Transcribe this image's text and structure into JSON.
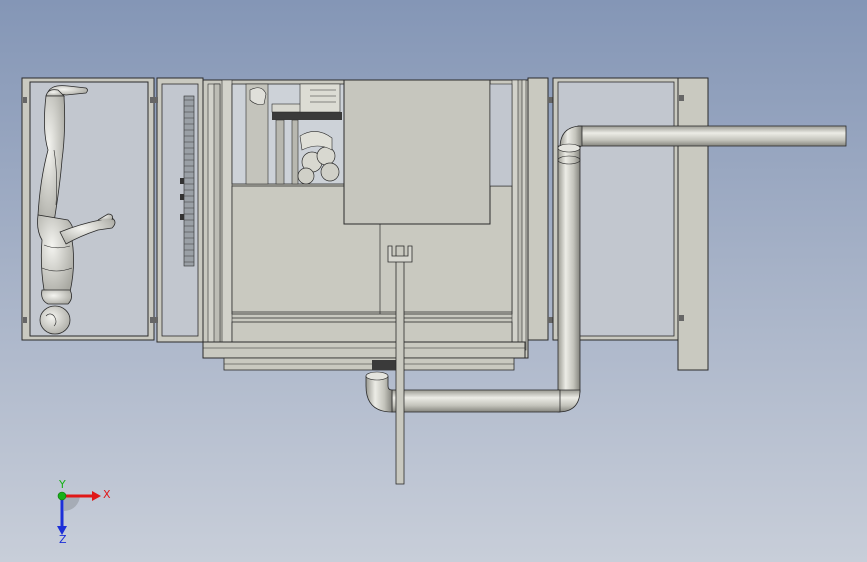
{
  "viewport": {
    "background_top": "#8496b6",
    "background_bottom": "#c8ced9"
  },
  "colors": {
    "part_fill": "#c9c9c0",
    "part_fill_light": "#d6d6cf",
    "part_edge": "#2b2b2b",
    "pipe_light": "#e2e2dc",
    "pipe_dark": "#8f8f88",
    "axis_x": "#e01818",
    "axis_y": "#18b018",
    "axis_z": "#1c2fd8"
  },
  "triad": {
    "x_label": "X",
    "y_label": "Y",
    "z_label": "Z",
    "icon": "axis-triad-icon"
  }
}
